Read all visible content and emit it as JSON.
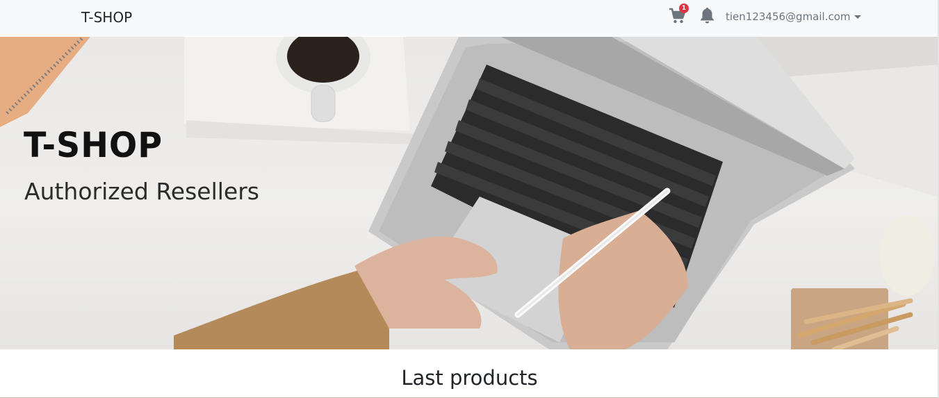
{
  "navbar": {
    "brand": "T-SHOP",
    "cart_icon": "shopping-cart-icon",
    "cart_count": "1",
    "notification_icon": "bell-icon",
    "user_email": "tien123456@gmail.com",
    "user_menu_icon": "caret-down-icon"
  },
  "hero": {
    "title": "T-SHOP",
    "subtitle": "Authorized Resellers"
  },
  "main": {
    "section_title": "Last products"
  }
}
